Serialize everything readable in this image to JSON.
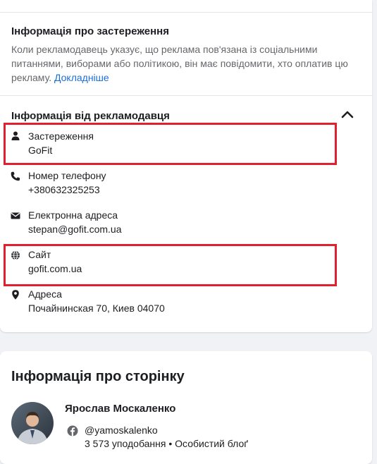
{
  "disclaimer_section": {
    "title": "Інформація про застереження",
    "text": "Коли рекламодавець указує, що реклама пов'язана із соціальними питаннями, виборами або політикою, він має повідомити, хто оплатив цю рекламу.",
    "link": "Докладніше"
  },
  "advertiser_section": {
    "title": "Інформація від рекламодавця",
    "rows": [
      {
        "icon": "person-icon",
        "label": "Застереження",
        "value": "GoFit"
      },
      {
        "icon": "phone-icon",
        "label": "Номер телефону",
        "value": "+380632325253"
      },
      {
        "icon": "envelope-icon",
        "label": "Електронна адреса",
        "value": "stepan@gofit.com.ua"
      },
      {
        "icon": "globe-icon",
        "label": "Сайт",
        "value": "gofit.com.ua"
      },
      {
        "icon": "location-pin-icon",
        "label": "Адреса",
        "value": "Почайнинская 70, Киев 04070"
      }
    ]
  },
  "page_section": {
    "title": "Інформація про сторінку",
    "name": "Ярослав Москаленко",
    "handle": "@yamoskalenko",
    "meta": "3 573 уподобання • Особистий блоґ"
  },
  "colors": {
    "highlight": "#e0202e",
    "link": "#1a6ed8",
    "secondary_text": "#65676b"
  }
}
